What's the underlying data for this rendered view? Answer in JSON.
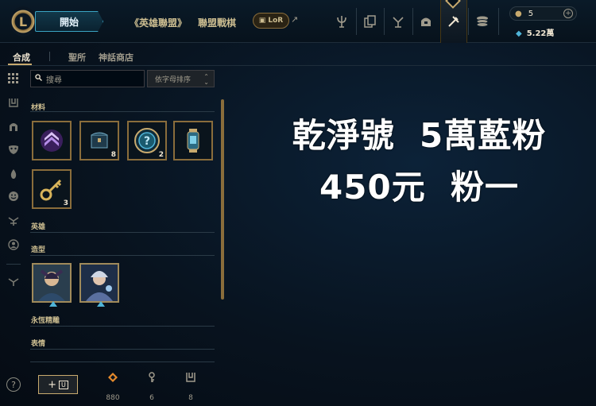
{
  "header": {
    "logo_glyph": "L",
    "play_button": "開始",
    "nav": [
      "《英雄聯盟》",
      "聯盟戰棋"
    ],
    "lor_label": "LoR",
    "external_icon": "external-link-icon",
    "nav_icons": [
      "trophy-icon",
      "collection-cards-icon",
      "ranked-icon",
      "loot-chest-icon",
      "crafting-icon",
      "store-coins-icon"
    ],
    "currency": {
      "rp": "5",
      "blue_essence": "5.22萬"
    }
  },
  "subtabs": [
    "合成",
    "聖所",
    "神話商店"
  ],
  "search": {
    "placeholder": "搜尋",
    "sort_label": "依字母排序"
  },
  "inventory": {
    "sections": [
      "材料",
      "英雄",
      "造型",
      "永恆精雕",
      "表情"
    ],
    "materials": [
      {
        "name": "chevron-token-icon",
        "count": ""
      },
      {
        "name": "loot-chest-icon",
        "count": "8"
      },
      {
        "name": "mystery-orb-icon",
        "count": "2"
      },
      {
        "name": "lantern-capsule-icon",
        "count": ""
      },
      {
        "name": "key-fragment-icon",
        "count": "3"
      }
    ],
    "skins": [
      "skin-shard-portrait-1",
      "skin-shard-portrait-2"
    ]
  },
  "bottom": {
    "add_label": "+",
    "resources": [
      {
        "icon": "orange-essence-icon",
        "value": "880",
        "color": "#e58a2c"
      },
      {
        "icon": "key-fragment-icon",
        "value": "6",
        "color": "#a09b8c"
      },
      {
        "icon": "chest-icon",
        "value": "8",
        "color": "#a09b8c"
      }
    ]
  },
  "banner": {
    "line1": "乾淨號  5萬藍粉",
    "line2": "450元  粉一"
  }
}
